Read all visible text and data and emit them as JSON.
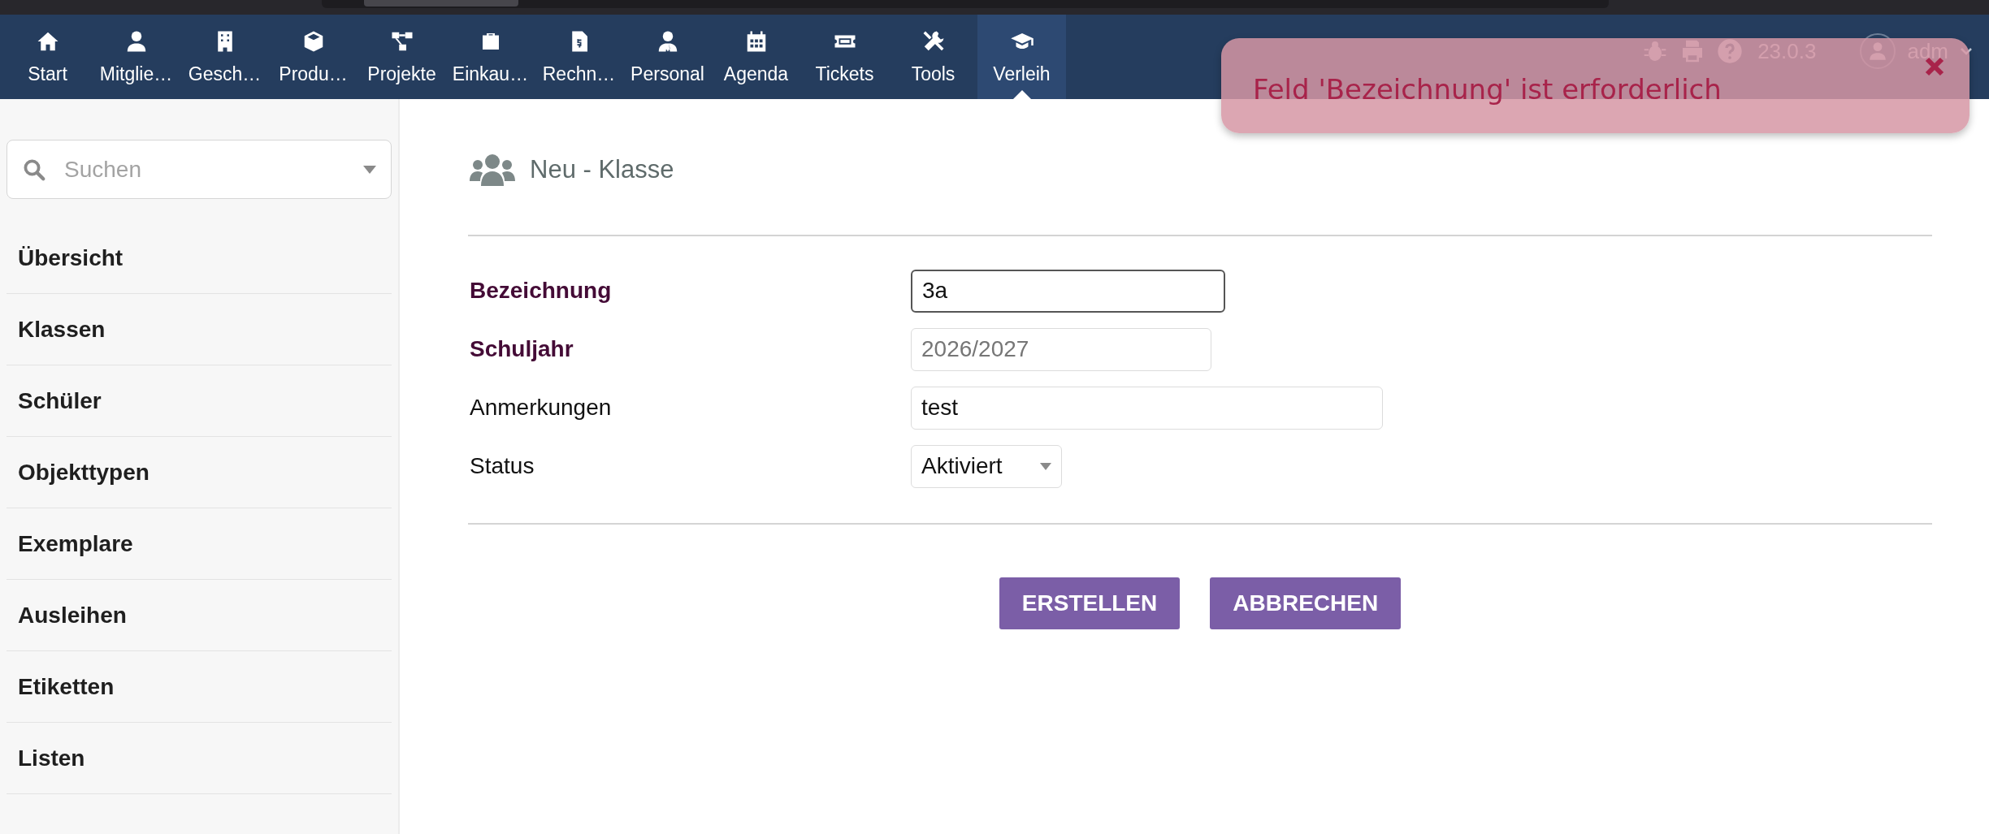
{
  "nav": {
    "items": [
      {
        "label": "Start",
        "selected": false
      },
      {
        "label": "Mitglie…",
        "selected": false
      },
      {
        "label": "Gesch…",
        "selected": false
      },
      {
        "label": "Produ…",
        "selected": false
      },
      {
        "label": "Projekte",
        "selected": false
      },
      {
        "label": "Einkau…",
        "selected": false
      },
      {
        "label": "Rechn…",
        "selected": false
      },
      {
        "label": "Personal",
        "selected": false
      },
      {
        "label": "Agenda",
        "selected": false
      },
      {
        "label": "Tickets",
        "selected": false
      },
      {
        "label": "Tools",
        "selected": false
      },
      {
        "label": "Verleih",
        "selected": true
      }
    ],
    "version": "23.0.3",
    "user": "adm"
  },
  "toast": {
    "message": "Feld 'Bezeichnung' ist erforderlich"
  },
  "sidebar": {
    "search": {
      "placeholder": "Suchen"
    },
    "items": [
      {
        "label": "Übersicht"
      },
      {
        "label": "Klassen"
      },
      {
        "label": "Schüler"
      },
      {
        "label": "Objekttypen"
      },
      {
        "label": "Exemplare"
      },
      {
        "label": "Ausleihen"
      },
      {
        "label": "Etiketten"
      },
      {
        "label": "Listen"
      }
    ]
  },
  "form": {
    "title": "Neu - Klasse",
    "fields": [
      {
        "label": "Bezeichnung",
        "required": true,
        "kind": "text",
        "value": "3a",
        "focused": true
      },
      {
        "label": "Schuljahr",
        "required": true,
        "kind": "text",
        "placeholder": "2026/2027",
        "focused": false
      },
      {
        "label": "Anmerkungen",
        "required": false,
        "kind": "text",
        "value": "test",
        "focused": false
      },
      {
        "label": "Status",
        "required": false,
        "kind": "select",
        "value": "Aktiviert",
        "focused": false
      }
    ],
    "buttons": [
      {
        "label": "ERSTELLEN"
      },
      {
        "label": "ABBRECHEN"
      }
    ]
  }
}
